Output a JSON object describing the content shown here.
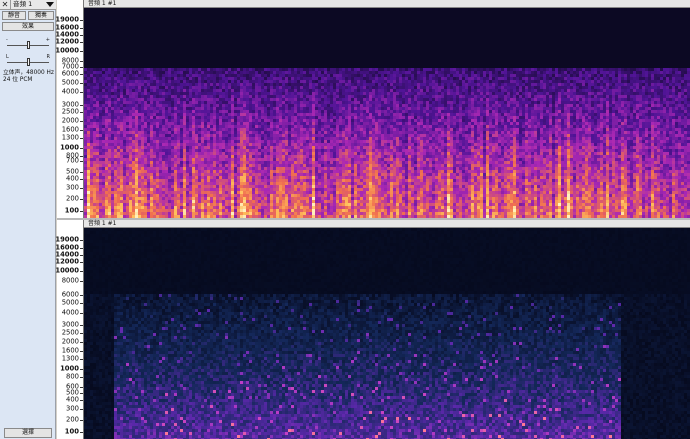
{
  "track": {
    "close_glyph": "✕",
    "name": "音頻 1",
    "mute_label": "靜音",
    "solo_label": "獨奏",
    "effects_label": "效果",
    "gain": {
      "min_label": "-",
      "max_label": "+",
      "level": 0.5
    },
    "pan": {
      "left_label": "L",
      "right_label": "R",
      "level": 0.5
    },
    "format_line1": "立体声，48000 Hz",
    "format_line2": "24 位 PCM",
    "select_label": "選擇"
  },
  "tracks": [
    {
      "title": "音頻 1 #1",
      "scale_labels": [
        "19000",
        "16000",
        "14000",
        "12000",
        "10000",
        "8000",
        "7000",
        "6000",
        "5000",
        "4000",
        "3000",
        "2500",
        "2000",
        "1600",
        "1300",
        "1000",
        "800",
        "700",
        "500",
        "400",
        "300",
        "200",
        "100"
      ]
    },
    {
      "title": "音頻 1 #1",
      "scale_labels": [
        "19000",
        "16000",
        "14000",
        "12000",
        "10000",
        "8000",
        "6000",
        "5000",
        "4000",
        "3000",
        "2500",
        "2000",
        "1600",
        "1300",
        "1000",
        "800",
        "600",
        "500",
        "400",
        "300",
        "200",
        "100"
      ]
    }
  ],
  "colors": {
    "spectrogram_low": "#07071f",
    "spectrogram_mid": "#7c1fd1",
    "spectrogram_high": "#ffe6a0"
  }
}
